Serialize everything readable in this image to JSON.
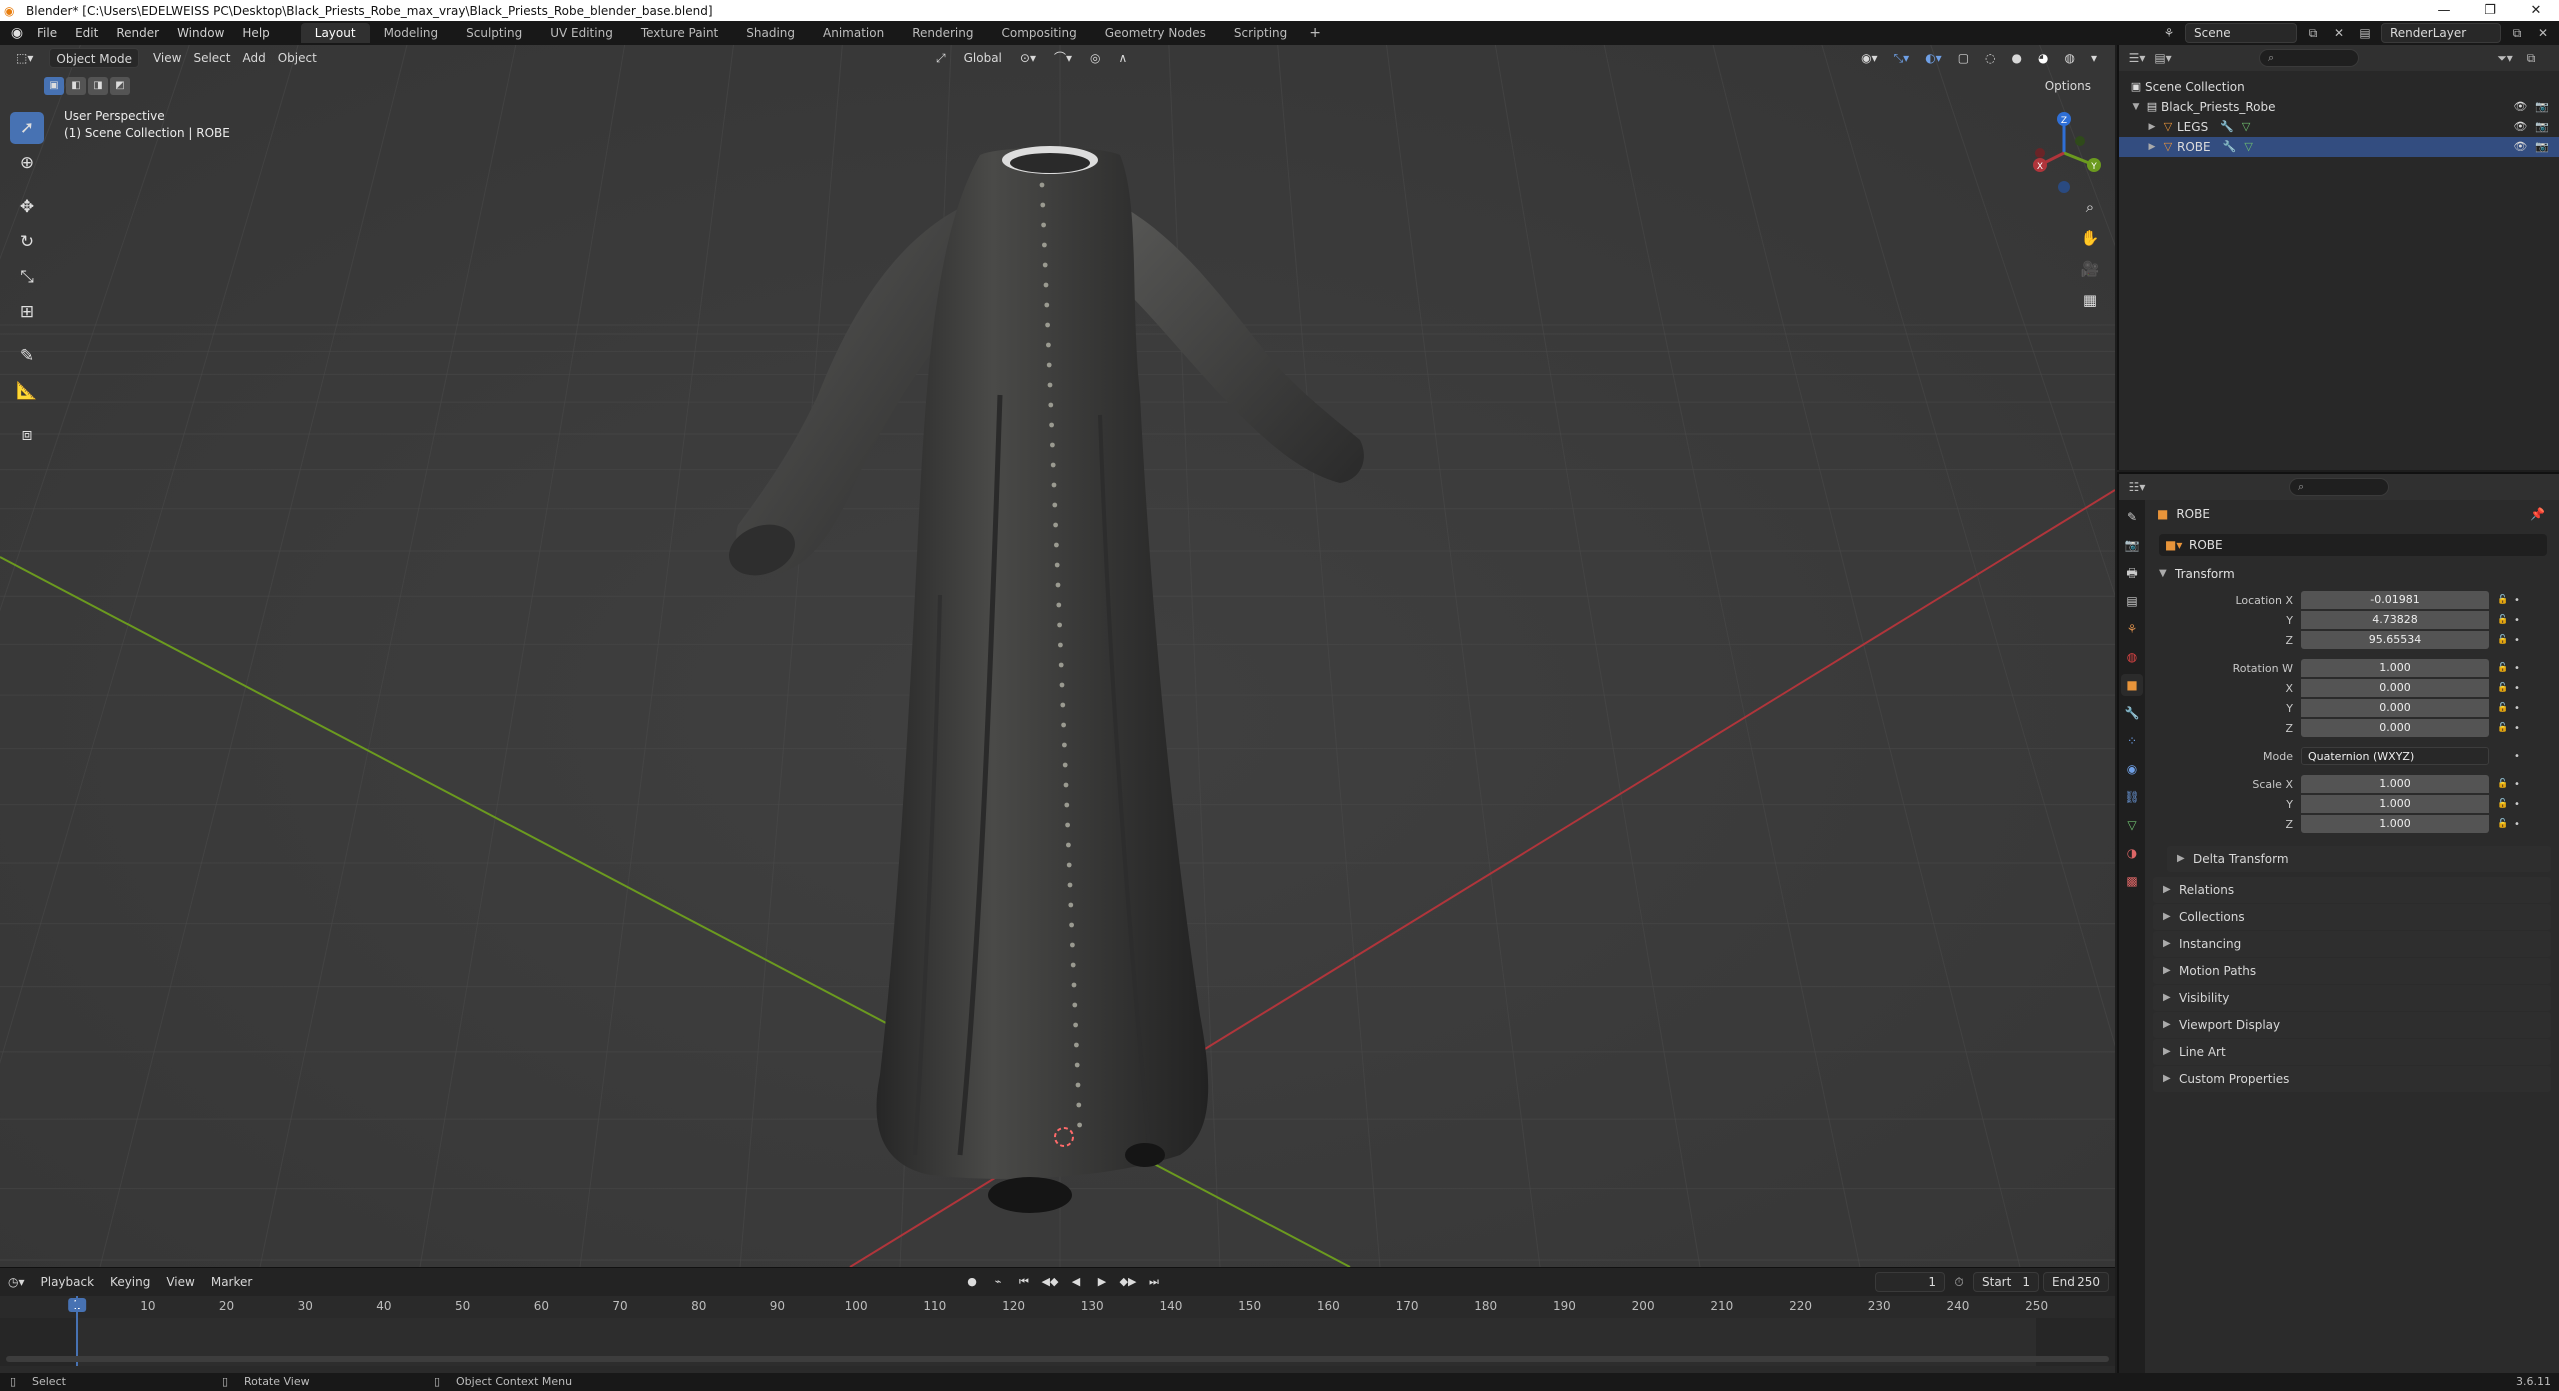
{
  "window": {
    "title": "Blender* [C:\\Users\\EDELWEISS PC\\Desktop\\Black_Priests_Robe_max_vray\\Black_Priests_Robe_blender_base.blend]",
    "buttons": [
      "—",
      "❐",
      "✕"
    ]
  },
  "menu": {
    "items": [
      "File",
      "Edit",
      "Render",
      "Window",
      "Help"
    ]
  },
  "workspaces": {
    "tabs": [
      "Layout",
      "Modeling",
      "Sculpting",
      "UV Editing",
      "Texture Paint",
      "Shading",
      "Animation",
      "Rendering",
      "Compositing",
      "Geometry Nodes",
      "Scripting"
    ],
    "active": "Layout",
    "add": "+"
  },
  "scene": {
    "name": "Scene",
    "view_layer": "RenderLayer"
  },
  "viewport": {
    "mode": "Object Mode",
    "menus": [
      "View",
      "Select",
      "Add",
      "Object"
    ],
    "orientation": "Global",
    "options": "Options",
    "info_line1": "User Perspective",
    "info_line2": "(1) Scene Collection | ROBE",
    "gizmo": {
      "x": "X",
      "y": "Y",
      "z": "Z"
    },
    "colors": {
      "bg": "#3c3c3c",
      "x_axis": "#b0353b",
      "y_axis": "#6b9a1f",
      "accent": "#4772b3"
    }
  },
  "timeline": {
    "menus": [
      "Playback",
      "Keying",
      "View",
      "Marker"
    ],
    "current_frame": "1",
    "start_label": "Start",
    "start": "1",
    "end_label": "End",
    "end": "250",
    "ticks": [
      "10",
      "20",
      "30",
      "40",
      "50",
      "60",
      "70",
      "80",
      "90",
      "100",
      "110",
      "120",
      "130",
      "140",
      "150",
      "160",
      "170",
      "180",
      "190",
      "200",
      "210",
      "220",
      "230",
      "240",
      "250"
    ]
  },
  "statusbar": {
    "select": "Select",
    "rotate": "Rotate View",
    "context": "Object Context Menu",
    "version": "3.6.11"
  },
  "outliner": {
    "root": "Scene Collection",
    "collection": "Black_Priests_Robe",
    "objects": [
      "LEGS",
      "ROBE"
    ]
  },
  "properties": {
    "object_name": "ROBE",
    "data_name": "ROBE",
    "transform_label": "Transform",
    "location_x_label": "Location X",
    "location_x": "-0.01981",
    "location_y": "4.73828",
    "location_z": "95.65534",
    "rotation_w_label": "Rotation W",
    "rotation_w": "1.000",
    "rotation_x": "0.000",
    "rotation_y": "0.000",
    "rotation_z": "0.000",
    "mode_label": "Mode",
    "mode": "Quaternion (WXYZ)",
    "scale_x_label": "Scale X",
    "scale_x": "1.000",
    "scale_y": "1.000",
    "scale_z": "1.000",
    "axis_y": "Y",
    "axis_z": "Z",
    "axis_x": "X",
    "delta_transform": "Delta Transform",
    "panels": [
      "Relations",
      "Collections",
      "Instancing",
      "Motion Paths",
      "Visibility",
      "Viewport Display",
      "Line Art",
      "Custom Properties"
    ]
  }
}
